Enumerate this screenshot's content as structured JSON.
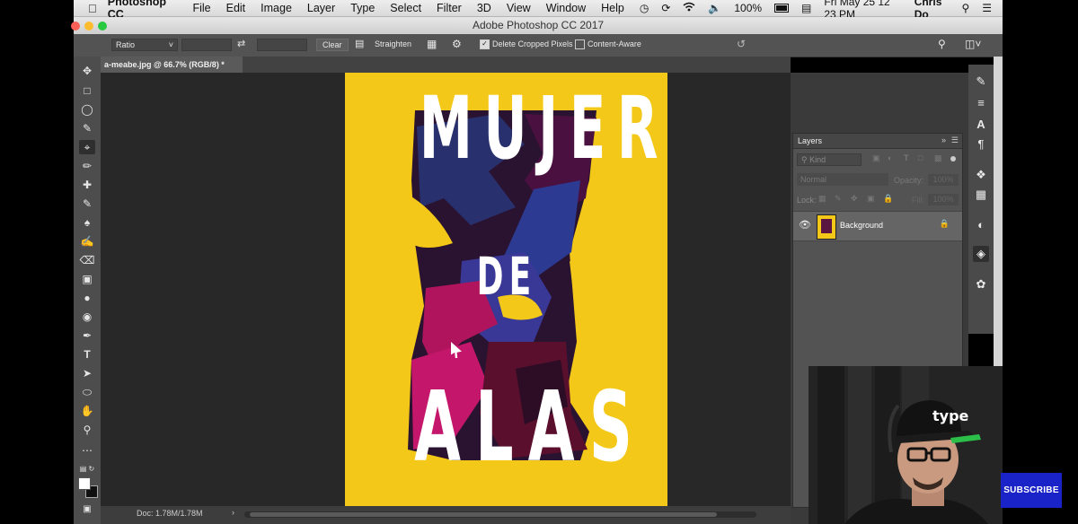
{
  "menubar": {
    "app": "Photoshop CC",
    "items": [
      "File",
      "Edit",
      "Image",
      "Layer",
      "Type",
      "Select",
      "Filter",
      "3D",
      "View",
      "Window",
      "Help"
    ],
    "battery": "100%",
    "datetime": "Fri May 25  12 23 PM",
    "user": "Chris Do"
  },
  "window": {
    "title": "Adobe Photoshop CC 2017"
  },
  "options": {
    "ratio": "Ratio",
    "clear": "Clear",
    "straighten": "Straighten",
    "delete_cropped": "Delete Cropped Pixels",
    "content_aware": "Content-Aware"
  },
  "doc": {
    "tab": "a-meabe.jpg @ 66.7% (RGB/8) *",
    "status": "Doc: 1.78M/1.78M"
  },
  "poster": {
    "line1": "MUJER",
    "line2": "DE",
    "line3": "ALAS",
    "bg_color": "#f4c818"
  },
  "layers_panel": {
    "title": "Layers",
    "kind": "Kind",
    "blend": "Normal",
    "opacity_label": "Opacity:",
    "opacity_value": "100%",
    "lock_label": "Lock:",
    "fill_label": "Fill:",
    "fill_value": "100%",
    "layers": [
      {
        "name": "Background",
        "visible": true,
        "locked": true
      }
    ]
  },
  "webcam": {
    "cap_text": "type"
  },
  "subscribe": "SUBSCRIBE",
  "colors": {
    "panel": "#535353",
    "canvas": "#282828",
    "accent": "#1a23c7"
  }
}
